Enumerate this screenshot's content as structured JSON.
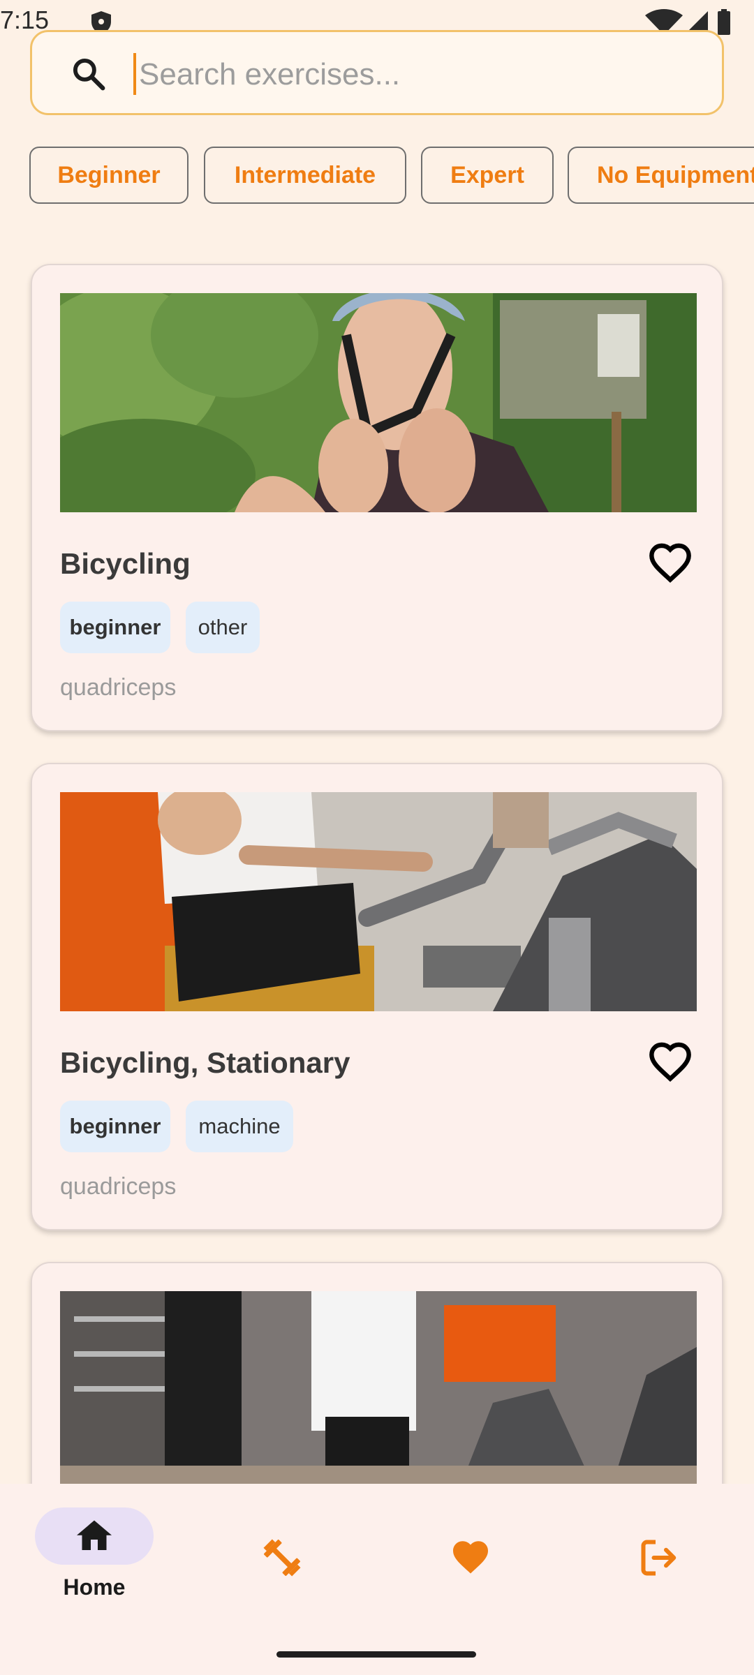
{
  "status_bar": {
    "time": "7:15"
  },
  "search": {
    "placeholder": "Search exercises...",
    "value": ""
  },
  "filters": [
    {
      "label": "Beginner"
    },
    {
      "label": "Intermediate"
    },
    {
      "label": "Expert"
    },
    {
      "label": "No Equipment"
    }
  ],
  "exercises": [
    {
      "name": "Bicycling",
      "level": "beginner",
      "category": "other",
      "muscle": "quadriceps"
    },
    {
      "name": "Bicycling, Stationary",
      "level": "beginner",
      "category": "machine",
      "muscle": "quadriceps"
    }
  ],
  "bottom_nav": {
    "items": [
      {
        "label": "Home",
        "icon": "home-icon",
        "selected": true
      },
      {
        "label": "",
        "icon": "dumbbell-icon",
        "selected": false
      },
      {
        "label": "",
        "icon": "heart-icon",
        "selected": false
      },
      {
        "label": "",
        "icon": "logout-icon",
        "selected": false
      }
    ]
  },
  "colors": {
    "accent": "#ef7d12",
    "background": "#fdf1e6",
    "card": "#fdf0ec",
    "tag": "#e3eefa",
    "nav_selected": "#e8dff5"
  }
}
